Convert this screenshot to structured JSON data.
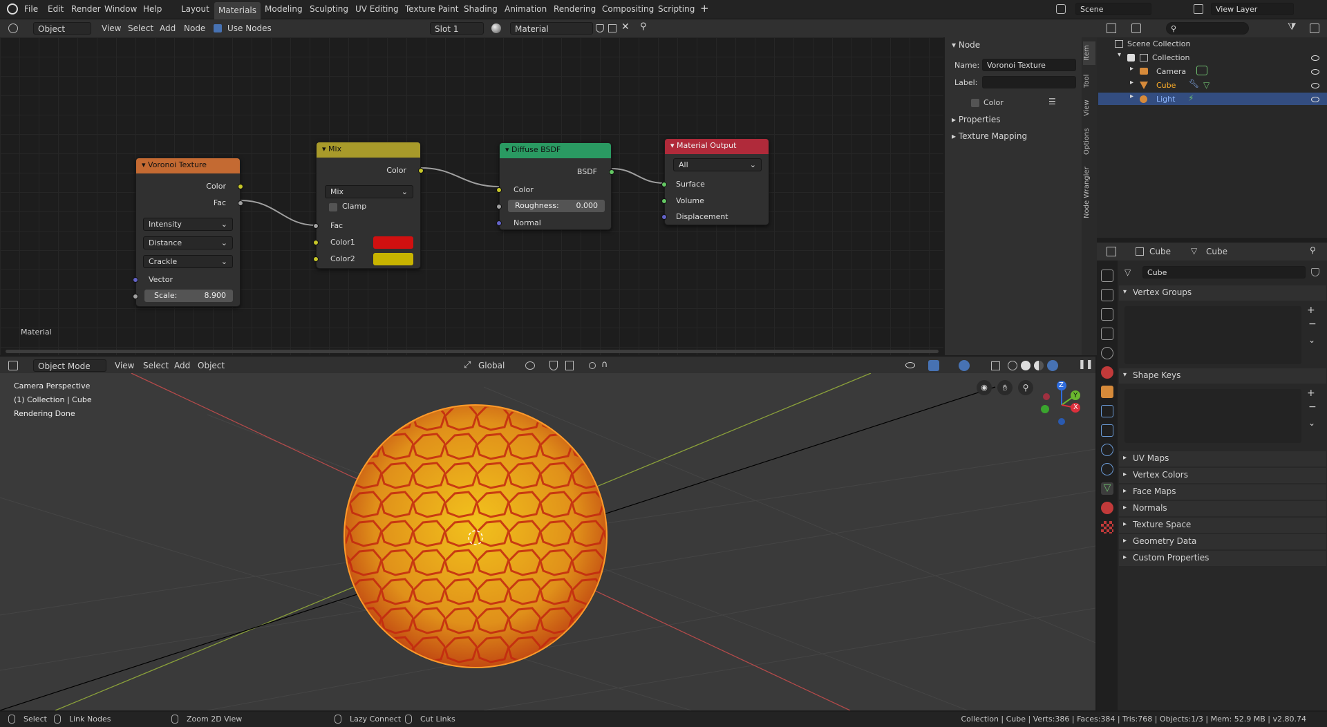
{
  "menubar": {
    "items": [
      "File",
      "Edit",
      "Render",
      "Window",
      "Help"
    ],
    "workspaces": [
      "Layout",
      "Materials",
      "Modeling",
      "Sculpting",
      "UV Editing",
      "Texture Paint",
      "Shading",
      "Animation",
      "Rendering",
      "Compositing",
      "Scripting"
    ],
    "plus": "+",
    "scene": "Scene",
    "view_layer": "View Layer"
  },
  "node_editor": {
    "header": {
      "mode": "Object",
      "menus": [
        "View",
        "Select",
        "Add",
        "Node"
      ],
      "use_nodes": "Use Nodes",
      "slot": "Slot 1",
      "material": "Material"
    },
    "label": "Material",
    "nodes": {
      "voronoi": {
        "title": "Voronoi Texture",
        "out_color": "Color",
        "out_fac": "Fac",
        "dd1": "Intensity",
        "dd2": "Distance",
        "dd3": "Crackle",
        "vector": "Vector",
        "scale_label": "Scale:",
        "scale_value": "8.900"
      },
      "mix": {
        "title": "Mix",
        "out_color": "Color",
        "mode": "Mix",
        "clamp": "Clamp",
        "fac": "Fac",
        "color1": "Color1",
        "color2": "Color2",
        "color1_value": "#d01010",
        "color2_value": "#c8b400"
      },
      "diffuse": {
        "title": "Diffuse BSDF",
        "out": "BSDF",
        "color": "Color",
        "roughness_label": "Roughness:",
        "roughness_value": "0.000",
        "normal": "Normal"
      },
      "output": {
        "title": "Material Output",
        "target": "All",
        "surface": "Surface",
        "volume": "Volume",
        "displacement": "Displacement"
      }
    },
    "sidebar": {
      "section": "Node",
      "name_label": "Name:",
      "name_value": "Voronoi Texture",
      "label_label": "Label:",
      "color": "Color",
      "properties": "Properties",
      "texture_mapping": "Texture Mapping"
    },
    "vtabs": [
      "Item",
      "Tool",
      "View",
      "Options",
      "Node Wrangler"
    ]
  },
  "viewport": {
    "header": {
      "mode": "Object Mode",
      "menus": [
        "View",
        "Select",
        "Add",
        "Object"
      ],
      "orientation": "Global"
    },
    "overlay_text": [
      "Camera Perspective",
      "(1) Collection | Cube",
      "Rendering Done"
    ],
    "gizmo": {
      "z": "Z",
      "y": "Y",
      "x": "X"
    }
  },
  "outliner": {
    "root": "Scene Collection",
    "collection": "Collection",
    "items": [
      "Camera",
      "Cube",
      "Light"
    ]
  },
  "properties": {
    "object": "Cube",
    "mesh": "Cube",
    "datablock": "Cube",
    "panels_open": [
      "Vertex Groups",
      "Shape Keys"
    ],
    "panels_closed": [
      "UV Maps",
      "Vertex Colors",
      "Face Maps",
      "Normals",
      "Texture Space",
      "Geometry Data",
      "Custom Properties"
    ]
  },
  "statusbar": {
    "select": "Select",
    "link_nodes": "Link Nodes",
    "zoom": "Zoom 2D View",
    "lazy": "Lazy Connect",
    "cut": "Cut Links",
    "stats": "Collection | Cube | Verts:386 | Faces:384 | Tris:768 | Objects:1/3 | Mem: 52.9 MB | v2.80.74"
  }
}
